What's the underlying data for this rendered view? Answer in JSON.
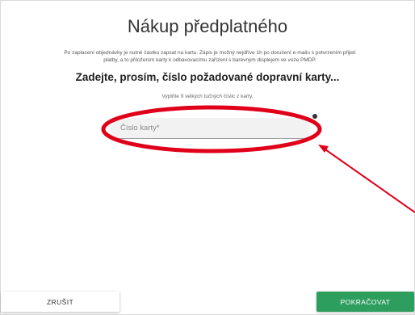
{
  "dialog": {
    "title": "Nákup předplatného",
    "info_text": "Po zaplacení objednávky je nutné částku zapsat na kartu. Zápis je možný nejdříve 1h po doručení e-mailu s potvrzením přijetí platby, a to přiložením karty k odbavovacímu zařízení s barevným displejem ve voze PMDP.",
    "heading": "Zadejte, prosím, číslo požadované dopravní karty...",
    "hint": "Vyplňte 9 velkých tučných číslic z karty.",
    "card_field": {
      "placeholder": "Číslo karty*",
      "value": ""
    }
  },
  "buttons": {
    "cancel_label": "ZRUŠIT",
    "continue_label": "POKRAČOVAT"
  },
  "colors": {
    "annotation": "#e0001a",
    "primary_button": "#2e9e5e"
  }
}
